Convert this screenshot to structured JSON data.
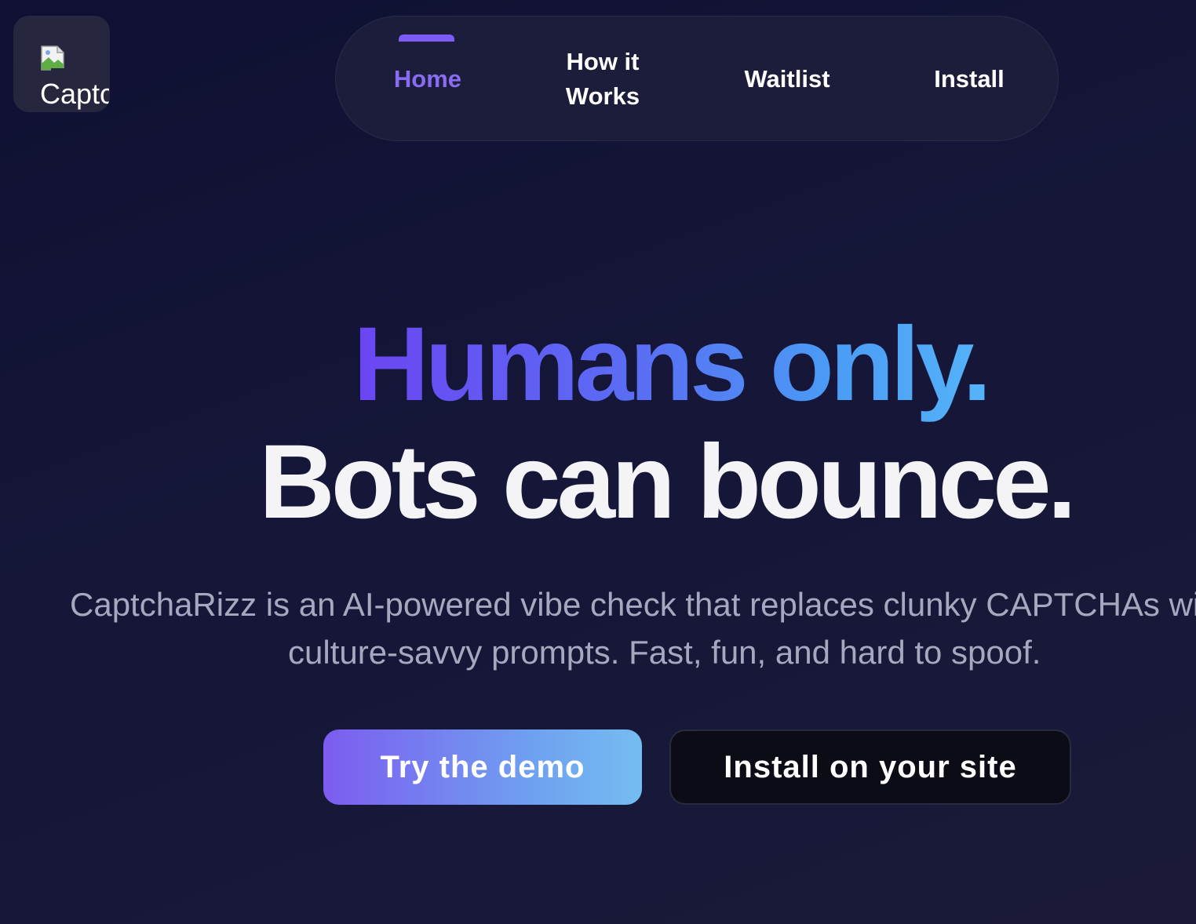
{
  "logo": {
    "alt_text": "CaptchaRizz"
  },
  "nav": {
    "items": [
      {
        "label": "Home",
        "active": true
      },
      {
        "label_line1": "How it",
        "label_line2": "Works",
        "active": false
      },
      {
        "label": "Waitlist",
        "active": false
      },
      {
        "label": "Install",
        "active": false
      }
    ]
  },
  "hero": {
    "headline_line1": "Humans only.",
    "headline_line2": "Bots can bounce.",
    "subtitle_line1": "CaptchaRizz is an AI-powered vibe check that replaces clunky CAPTCHAs with",
    "subtitle_line2": "culture-savvy prompts. Fast, fun, and hard to spoof."
  },
  "buttons": {
    "demo_label": "Try the demo",
    "install_label": "Install on your site"
  },
  "colors": {
    "background": "#12123a",
    "nav_background": "#1c1d3a",
    "accent_purple": "#7c5cf5",
    "accent_blue": "#55b4f8",
    "subtitle_text": "#a7a8bf"
  }
}
